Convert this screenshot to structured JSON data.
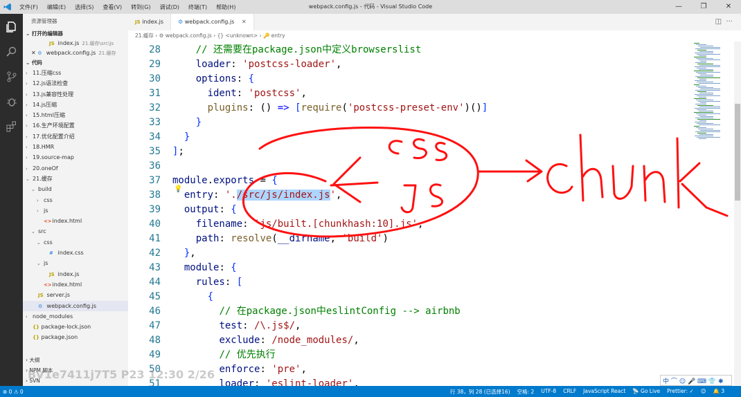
{
  "titlebar": {
    "menus": [
      "文件(F)",
      "编辑(E)",
      "选择(S)",
      "查看(V)",
      "转到(G)",
      "调试(D)",
      "终端(T)",
      "帮助(H)"
    ],
    "title": "webpack.config.js - 代码 - Visual Studio Code",
    "controls": [
      "—",
      "❐",
      "✕"
    ]
  },
  "sidebar": {
    "title": "资源管理器",
    "open_editors_label": "打开的编辑器",
    "open_editors": [
      {
        "name": "index.js",
        "path": "21.缓存\\src\\js",
        "icon": "JS"
      },
      {
        "name": "webpack.config.js",
        "path": "21.缓存",
        "icon": "⚙"
      }
    ],
    "folder_label": "代码",
    "tree": [
      {
        "label": "11.压缩css",
        "depth": 1,
        "twisty": "›",
        "icon": ""
      },
      {
        "label": "12.js语法检查",
        "depth": 1,
        "twisty": "›",
        "icon": ""
      },
      {
        "label": "13.js兼容性处理",
        "depth": 1,
        "twisty": "›",
        "icon": ""
      },
      {
        "label": "14.js压缩",
        "depth": 1,
        "twisty": "›",
        "icon": ""
      },
      {
        "label": "15.html压缩",
        "depth": 1,
        "twisty": "›",
        "icon": ""
      },
      {
        "label": "16.生产环境配置",
        "depth": 1,
        "twisty": "›",
        "icon": ""
      },
      {
        "label": "17.优化配置介绍",
        "depth": 1,
        "twisty": "›",
        "icon": ""
      },
      {
        "label": "18.HMR",
        "depth": 1,
        "twisty": "›",
        "icon": ""
      },
      {
        "label": "19.source-map",
        "depth": 1,
        "twisty": "›",
        "icon": ""
      },
      {
        "label": "20.oneOf",
        "depth": 1,
        "twisty": "›",
        "icon": ""
      },
      {
        "label": "21.缓存",
        "depth": 1,
        "twisty": "⌄",
        "icon": ""
      },
      {
        "label": "build",
        "depth": 2,
        "twisty": "⌄",
        "icon": ""
      },
      {
        "label": "css",
        "depth": 3,
        "twisty": "›",
        "icon": ""
      },
      {
        "label": "js",
        "depth": 3,
        "twisty": "›",
        "icon": ""
      },
      {
        "label": "index.html",
        "depth": 3,
        "twisty": "",
        "icon": "<>"
      },
      {
        "label": "src",
        "depth": 2,
        "twisty": "⌄",
        "icon": ""
      },
      {
        "label": "css",
        "depth": 3,
        "twisty": "⌄",
        "icon": ""
      },
      {
        "label": "index.css",
        "depth": 4,
        "twisty": "",
        "icon": "#"
      },
      {
        "label": "js",
        "depth": 3,
        "twisty": "⌄",
        "icon": ""
      },
      {
        "label": "index.js",
        "depth": 4,
        "twisty": "",
        "icon": "JS"
      },
      {
        "label": "index.html",
        "depth": 3,
        "twisty": "",
        "icon": "<>"
      },
      {
        "label": "server.js",
        "depth": 2,
        "twisty": "",
        "icon": "JS"
      },
      {
        "label": "webpack.config.js",
        "depth": 2,
        "twisty": "",
        "icon": "⚙",
        "selected": true
      },
      {
        "label": "node_modules",
        "depth": 1,
        "twisty": "›",
        "icon": ""
      },
      {
        "label": "package-lock.json",
        "depth": 1,
        "twisty": "",
        "icon": "{}"
      },
      {
        "label": "package.json",
        "depth": 1,
        "twisty": "",
        "icon": "{}"
      }
    ],
    "bottom_sections": [
      "大纲",
      "NPM 脚本",
      "SVN"
    ]
  },
  "tabs": [
    {
      "label": "index.js",
      "icon": "JS",
      "active": false
    },
    {
      "label": "webpack.config.js",
      "icon": "⚙",
      "active": true
    }
  ],
  "breadcrumb": "21.缓存 › ⚙ webpack.config.js › {} <unknown> › 🔑 entry",
  "editor": {
    "lines": [
      {
        "n": "28",
        "html": "    <span class='cm'>// 还需要在package.json中定义browserslist</span>"
      },
      {
        "n": "29",
        "html": "    <span class='pr'>loader</span>: <span class='st'>'postcss-loader'</span>,"
      },
      {
        "n": "30",
        "html": "    <span class='pr'>options</span>: <span class='bk'>{</span>"
      },
      {
        "n": "31",
        "html": "      <span class='pr'>ident</span>: <span class='st'>'postcss'</span>,"
      },
      {
        "n": "32",
        "html": "      <span class='fn'>plugins</span>: () <span class='kw'>=&gt;</span> <span class='bk'>[</span><span class='fn'>require</span>(<span class='st'>'postcss-preset-env'</span>)()<span class='bk'>]</span>"
      },
      {
        "n": "33",
        "html": "    <span class='bk'>}</span>"
      },
      {
        "n": "34",
        "html": "  <span class='bk'>}</span>"
      },
      {
        "n": "35",
        "html": "<span class='bk'>]</span>;"
      },
      {
        "n": "36",
        "html": ""
      },
      {
        "n": "37",
        "html": "<span class='pr'>module</span>.<span class='pr'>exports</span> = <span class='bk'>{</span>"
      },
      {
        "n": "38",
        "html": "  <span class='pr'>entry</span>: <span class='st'>'.<span class='sel-txt'>/src/js/index.js</span>'</span>,"
      },
      {
        "n": "39",
        "html": "  <span class='pr'>output</span>: <span class='bk'>{</span>"
      },
      {
        "n": "40",
        "html": "    <span class='pr'>filename</span>: <span class='st'>'js/built.[chunkhash:10].js'</span>,"
      },
      {
        "n": "41",
        "html": "    <span class='pr'>path</span>: <span class='fn'>resolve</span>(<span class='pr'>__dirname</span>, <span class='st'>'build'</span>)"
      },
      {
        "n": "42",
        "html": "  <span class='bk'>}</span>,"
      },
      {
        "n": "43",
        "html": "  <span class='pr'>module</span>: <span class='bk'>{</span>"
      },
      {
        "n": "44",
        "html": "    <span class='pr'>rules</span>: <span class='bk'>[</span>"
      },
      {
        "n": "45",
        "html": "      <span class='bk'>{</span>"
      },
      {
        "n": "46",
        "html": "        <span class='cm'>// 在package.json中eslintConfig --&gt; airbnb</span>"
      },
      {
        "n": "47",
        "html": "        <span class='pr'>test</span>: <span class='st'>/\\.js$/</span>,"
      },
      {
        "n": "48",
        "html": "        <span class='pr'>exclude</span>: <span class='st'>/node_modules/</span>,"
      },
      {
        "n": "49",
        "html": "        <span class='cm'>// 优先执行</span>"
      },
      {
        "n": "50",
        "html": "        <span class='pr'>enforce</span>: <span class='st'>'pre'</span>,"
      },
      {
        "n": "51",
        "html": "        <span class='pr'>loader</span>: <span class='st'>'eslint-loader'</span>,"
      }
    ]
  },
  "annotations": {
    "css": "css",
    "js": "js",
    "chunk": "chunk"
  },
  "ime": "中 ⌒ ☺ 🎤 ⌨ 👕 ✱",
  "watermark": "BV1e7411j7T5 P23 12:30 2/26",
  "statusbar": {
    "left": "⊗ 0 ⚠ 0",
    "items": [
      "行 38，列 28 (已选择16)",
      "空格: 2",
      "UTF-8",
      "CRLF",
      "JavaScript React",
      "📡 Go Live",
      "Prettier: ✓",
      "😊",
      "🔔 3"
    ]
  },
  "colors": {
    "accent": "#007acc",
    "ink": "#ff0000"
  }
}
